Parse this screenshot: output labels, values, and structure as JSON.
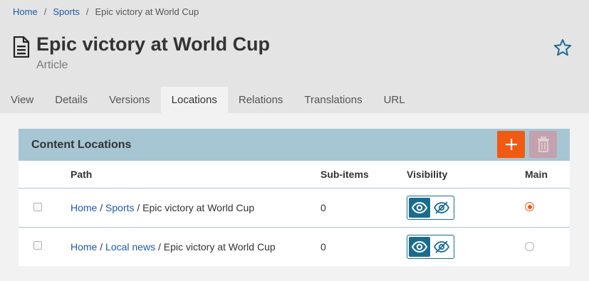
{
  "breadcrumb": {
    "items": [
      "Home",
      "Sports"
    ],
    "current": "Epic victory at World Cup",
    "separator": "/"
  },
  "page": {
    "title": "Epic victory at World Cup",
    "subtitle": "Article",
    "icon": "article-icon"
  },
  "tabs": [
    {
      "label": "View",
      "active": false
    },
    {
      "label": "Details",
      "active": false
    },
    {
      "label": "Versions",
      "active": false
    },
    {
      "label": "Locations",
      "active": true
    },
    {
      "label": "Relations",
      "active": false
    },
    {
      "label": "Translations",
      "active": false
    },
    {
      "label": "URL",
      "active": false
    }
  ],
  "panel": {
    "title": "Content Locations",
    "add_icon": "plus-icon",
    "delete_icon": "trash-icon",
    "columns": [
      "Path",
      "Sub-items",
      "Visibility",
      "Main"
    ],
    "rows": [
      {
        "path_links": [
          "Home",
          "Sports"
        ],
        "path_leaf": "Epic victory at World Cup",
        "subitems": "0",
        "visible": true,
        "main": true
      },
      {
        "path_links": [
          "Home",
          "Local news"
        ],
        "path_leaf": "Epic victory at World Cup",
        "subitems": "0",
        "visible": true,
        "main": false
      }
    ]
  },
  "colors": {
    "header_bg": "#e5e4e5",
    "panel_head_bg": "#a6c6d4",
    "accent_orange": "#f15a10",
    "link_blue": "#1d5aa5",
    "visibility_teal": "#1a6c8f"
  }
}
